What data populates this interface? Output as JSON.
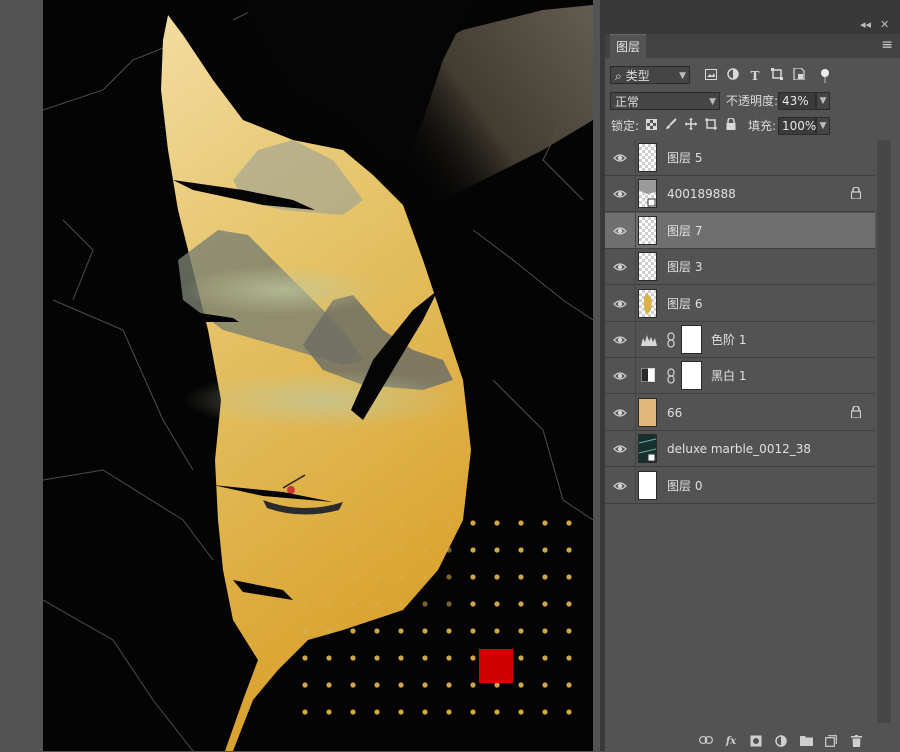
{
  "panel": {
    "collapse_icon": "◂◂",
    "close_icon": "✕",
    "tab_label": "图层",
    "menu_icon": "≡"
  },
  "filter": {
    "search_icon": "⌕",
    "kind_value": "类型",
    "icons": [
      "image-filter-icon",
      "adjustment-filter-icon",
      "type-filter-icon",
      "shape-filter-icon",
      "smart-object-filter-icon",
      "filter-toggle-icon"
    ]
  },
  "blend": {
    "mode_value": "正常",
    "opacity_label": "不透明度:",
    "opacity_value": "43%"
  },
  "lock": {
    "label": "锁定:",
    "fill_label": "填充:",
    "fill_value": "100%"
  },
  "layers": [
    {
      "name": "图层 5",
      "type": "transparent",
      "locked": false,
      "selected": false
    },
    {
      "name": "400189888",
      "type": "smart",
      "locked": true,
      "selected": false
    },
    {
      "name": "图层 7",
      "type": "transparent",
      "locked": false,
      "selected": true
    },
    {
      "name": "图层 3",
      "type": "transparent",
      "locked": false,
      "selected": false
    },
    {
      "name": "图层 6",
      "type": "leaf",
      "locked": false,
      "selected": false
    },
    {
      "name": "色阶 1",
      "type": "adjust-levels",
      "locked": false,
      "selected": false
    },
    {
      "name": "黑白 1",
      "type": "adjust-bw",
      "locked": false,
      "selected": false
    },
    {
      "name": "66",
      "type": "gold",
      "locked": true,
      "selected": false
    },
    {
      "name": "deluxe marble_0012_38",
      "type": "marble",
      "locked": false,
      "selected": false
    },
    {
      "name": "图层 0",
      "type": "white",
      "locked": false,
      "selected": false
    }
  ],
  "bottom_bar": [
    "link-layers-icon",
    "fx-icon",
    "add-mask-icon",
    "new-adjustment-icon",
    "new-group-icon",
    "new-layer-icon",
    "delete-layer-icon"
  ],
  "colors": {
    "gold": "#d9b04a",
    "red": "#d10000",
    "panel_bg": "#535353",
    "selected_row": "#6f6f6f"
  }
}
